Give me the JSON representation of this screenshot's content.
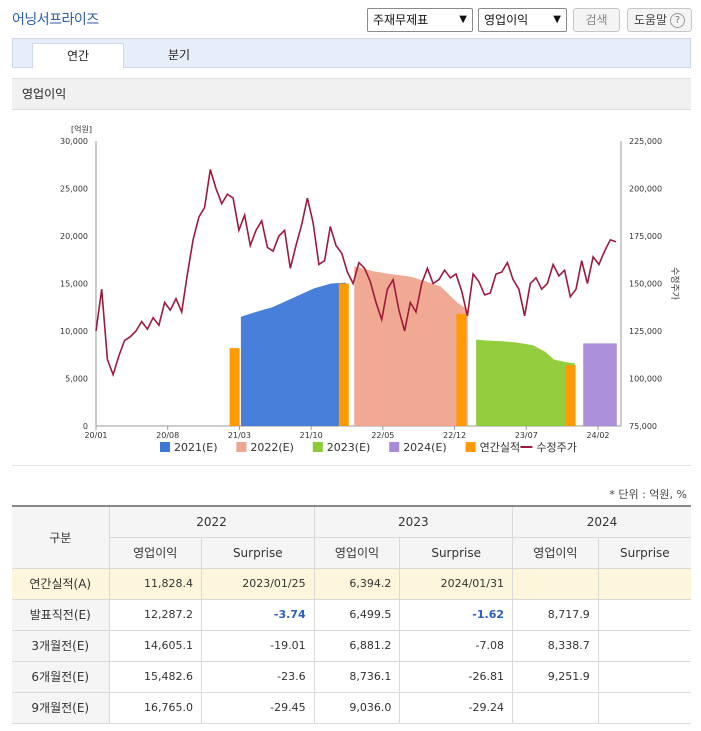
{
  "header": {
    "title": "어닝서프라이즈",
    "select_topic": "주재무제표",
    "select_item": "영업이익",
    "search_label": "검색",
    "help_label": "도움말",
    "help_glyph": "?"
  },
  "tabs": [
    {
      "label": "연간",
      "active": true
    },
    {
      "label": "분기",
      "active": false
    }
  ],
  "section_title": "영업이익",
  "chart_data": {
    "type": "area",
    "y_left": {
      "label": "[억원]",
      "ticks": [
        "30,000",
        "25,000",
        "20,000",
        "15,000",
        "10,000",
        "5,000",
        "0"
      ],
      "range": [
        0,
        30000
      ]
    },
    "y_right": {
      "label": "수정주가",
      "ticks": [
        "225,000",
        "200,000",
        "175,000",
        "150,000",
        "125,000",
        "100,000",
        "75,000"
      ],
      "range": [
        75000,
        225000
      ]
    },
    "x_ticks": [
      "20/01",
      "20/08",
      "21/03",
      "21/10",
      "22/05",
      "22/12",
      "23/07",
      "24/02"
    ],
    "consensus_series": [
      {
        "name": "2021(E)",
        "color": "#3d78d8",
        "points": [
          [
            0.345,
            11500
          ],
          [
            0.38,
            12000
          ],
          [
            0.42,
            12500
          ],
          [
            0.47,
            13500
          ],
          [
            0.52,
            14500
          ],
          [
            0.56,
            15000
          ],
          [
            0.595,
            15100
          ]
        ]
      },
      {
        "name": "2022(E)",
        "color": "#efa48c",
        "points": [
          [
            0.615,
            16800
          ],
          [
            0.66,
            16300
          ],
          [
            0.7,
            16000
          ],
          [
            0.75,
            15700
          ],
          [
            0.8,
            15000
          ],
          [
            0.82,
            14700
          ],
          [
            0.86,
            13000
          ],
          [
            0.885,
            12200
          ]
        ]
      },
      {
        "name": "2023(E)",
        "color": "#8ccb33",
        "points": [
          [
            0.905,
            9100
          ],
          [
            0.93,
            9000
          ],
          [
            0.97,
            8900
          ],
          [
            1.0,
            8800
          ],
          [
            1.04,
            8500
          ],
          [
            1.07,
            7800
          ],
          [
            1.09,
            7000
          ],
          [
            1.12,
            6700
          ],
          [
            1.14,
            6600
          ]
        ]
      },
      {
        "name": "2024(E)",
        "color": "#a98ad8",
        "points": [
          [
            1.16,
            8700
          ],
          [
            1.2,
            8700
          ],
          [
            1.24,
            8700
          ]
        ]
      }
    ],
    "actual_bars": {
      "name": "연간실적",
      "color": "#ff9a05",
      "bars": [
        [
          0.33,
          8200
        ],
        [
          0.59,
          15000
        ],
        [
          0.87,
          11800
        ],
        [
          1.13,
          6400
        ]
      ]
    },
    "price_series": {
      "name": "수정주가",
      "color": "#9c1a3c",
      "values": [
        125000,
        147000,
        110000,
        102000,
        112000,
        120000,
        122000,
        125000,
        130000,
        126000,
        132000,
        128000,
        140000,
        136000,
        142000,
        135000,
        155000,
        173000,
        185000,
        190000,
        210000,
        200000,
        192000,
        197000,
        195000,
        178000,
        186000,
        170000,
        178000,
        183000,
        169000,
        167000,
        175000,
        178000,
        158000,
        170000,
        181000,
        195000,
        182000,
        160000,
        162000,
        180000,
        170000,
        166000,
        156000,
        150000,
        161000,
        158000,
        151000,
        140000,
        131000,
        147000,
        152000,
        136000,
        125000,
        140000,
        135000,
        150000,
        158000,
        150000,
        152000,
        157000,
        153000,
        155000,
        146000,
        133000,
        155000,
        151000,
        144000,
        145000,
        155000,
        156000,
        161000,
        152000,
        147000,
        133000,
        150000,
        153000,
        147000,
        150000,
        160000,
        154000,
        157000,
        143000,
        147000,
        162000,
        150000,
        164000,
        160000,
        167000,
        173000,
        172000
      ]
    },
    "legend": [
      "2021(E)",
      "2022(E)",
      "2023(E)",
      "2024(E)",
      "연간실적",
      "수정주가"
    ]
  },
  "table": {
    "unit_note": "* 단위 : 억원, %",
    "header_label": "구분",
    "years": [
      "2022",
      "2023",
      "2024"
    ],
    "sub_headers": [
      "영업이익",
      "Surprise"
    ],
    "rows": [
      {
        "label": "연간실적(A)",
        "cells": [
          "11,828.4",
          "2023/01/25",
          "6,394.2",
          "2024/01/31",
          "",
          ""
        ]
      },
      {
        "label": "발표직전(E)",
        "cells": [
          "12,287.2",
          "-3.74",
          "6,499.5",
          "-1.62",
          "8,717.9",
          ""
        ]
      },
      {
        "label": "3개월전(E)",
        "cells": [
          "14,605.1",
          "-19.01",
          "6,881.2",
          "-7.08",
          "8,338.7",
          ""
        ]
      },
      {
        "label": "6개월전(E)",
        "cells": [
          "15,482.6",
          "-23.6",
          "8,736.1",
          "-26.81",
          "9,251.9",
          ""
        ]
      },
      {
        "label": "9개월전(E)",
        "cells": [
          "16,765.0",
          "-29.45",
          "9,036.0",
          "-29.24",
          "",
          ""
        ]
      }
    ]
  }
}
